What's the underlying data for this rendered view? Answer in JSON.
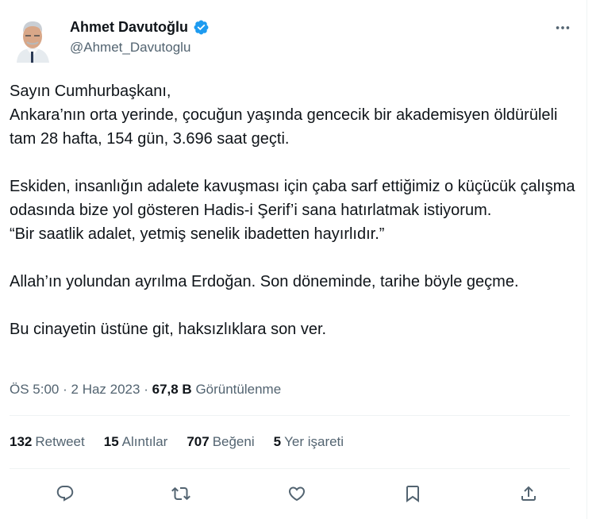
{
  "author": {
    "name": "Ahmet Davutoğlu",
    "handle": "@Ahmet_Davutoglu",
    "verified_color": "#1d9bf0"
  },
  "tweet": {
    "paragraphs": [
      "Sayın Cumhurbaşkanı,\nAnkara’nın orta yerinde, çocuğun yaşında gencecik bir akademisyen öldürüleli tam 28 hafta, 154 gün, 3.696 saat geçti.",
      "Eskiden, insanlığın adalete kavuşması için çaba sarf ettiğimiz o küçücük çalışma odasında bize yol gösteren Hadis-i Şerif’i sana hatırlatmak istiyorum.\n“Bir saatlik adalet, yetmiş senelik ibadetten hayırlıdır.”",
      "Allah’ın yolundan ayrılma Erdoğan. Son döneminde, tarihe böyle geçme.",
      "Bu cinayetin üstüne git, haksızlıklara son ver."
    ]
  },
  "meta": {
    "time": "ÖS 5:00",
    "separator": "·",
    "date": "2 Haz 2023",
    "views_count": "67,8 B",
    "views_label": "Görüntülenme"
  },
  "stats": [
    {
      "count": "132",
      "label": "Retweet"
    },
    {
      "count": "15",
      "label": "Alıntılar"
    },
    {
      "count": "707",
      "label": "Beğeni"
    },
    {
      "count": "5",
      "label": "Yer işareti"
    }
  ],
  "actions": [
    "reply-icon",
    "retweet-icon",
    "like-icon",
    "bookmark-icon",
    "share-icon"
  ],
  "colors": {
    "text": "#0f1419",
    "secondary": "#536471",
    "divider": "#eff3f4",
    "accent": "#1d9bf0"
  }
}
